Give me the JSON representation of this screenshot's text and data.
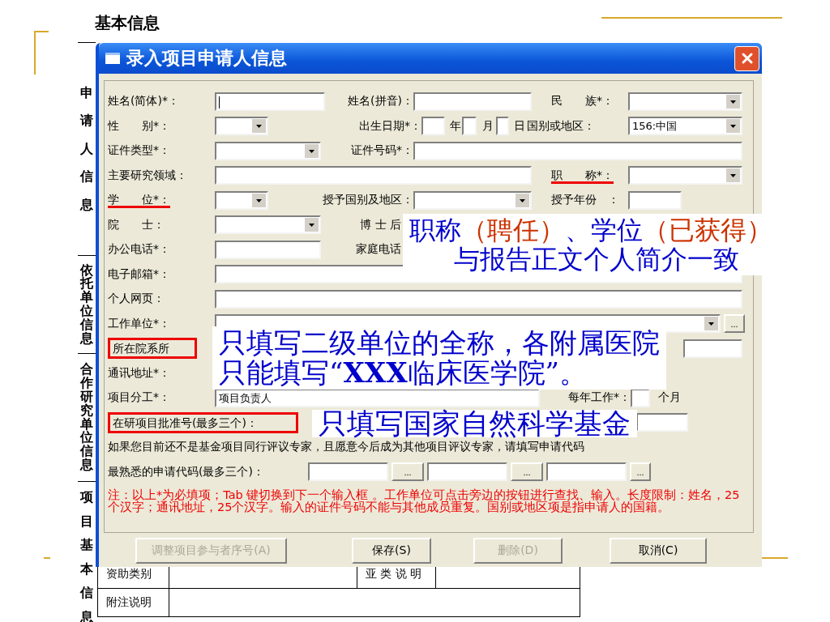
{
  "slide": {
    "heading": "基本信息",
    "side_sections": [
      {
        "label": "申请人信息"
      },
      {
        "label": "依托单位信息"
      },
      {
        "label": "合作研究单位信息"
      },
      {
        "label": "项目基本信息"
      }
    ],
    "table_rows": [
      {
        "cells": [
          "资助类别",
          "亚 类 说 明"
        ]
      },
      {
        "cells": [
          "附注说明"
        ]
      }
    ]
  },
  "dialog": {
    "title": "录入项目申请人信息",
    "rows": [
      {
        "items": [
          {
            "kind": "label",
            "text": "姓名(简体)*："
          },
          {
            "kind": "field",
            "focused": true
          },
          {
            "kind": "label",
            "text": "姓名(拼音)："
          },
          {
            "kind": "field"
          },
          {
            "kind": "label",
            "text": "民　　族*："
          },
          {
            "kind": "select"
          }
        ]
      },
      {
        "items": [
          {
            "kind": "label",
            "text": "性　　别*："
          },
          {
            "kind": "select"
          },
          {
            "kind": "label",
            "text": "出生日期*："
          },
          {
            "kind": "field"
          },
          {
            "kind": "unit",
            "text": "年"
          },
          {
            "kind": "field"
          },
          {
            "kind": "unit",
            "text": "月"
          },
          {
            "kind": "field"
          },
          {
            "kind": "unit",
            "text": "日"
          },
          {
            "kind": "label",
            "text": "国别或地区："
          },
          {
            "kind": "select",
            "value": "156:中国"
          }
        ]
      },
      {
        "items": [
          {
            "kind": "label",
            "text": "证件类型*："
          },
          {
            "kind": "select"
          },
          {
            "kind": "label",
            "text": "证件号码*："
          },
          {
            "kind": "field"
          }
        ]
      },
      {
        "items": [
          {
            "kind": "label",
            "text": "主要研究领域："
          },
          {
            "kind": "field"
          },
          {
            "kind": "label",
            "text": "职　　称*：",
            "underlined": true
          },
          {
            "kind": "select"
          }
        ]
      },
      {
        "items": [
          {
            "kind": "label",
            "text": "学　　位*：",
            "underlined": true
          },
          {
            "kind": "select"
          },
          {
            "kind": "label",
            "text": "授予国别及地区："
          },
          {
            "kind": "select"
          },
          {
            "kind": "label",
            "text": "授予年份　："
          },
          {
            "kind": "field"
          }
        ]
      },
      {
        "items": [
          {
            "kind": "label",
            "text": "院　　士："
          },
          {
            "kind": "select"
          },
          {
            "kind": "label",
            "text": "博 士 后"
          }
        ]
      },
      {
        "items": [
          {
            "kind": "label",
            "text": "办公电话*："
          },
          {
            "kind": "field"
          },
          {
            "kind": "label",
            "text": "家庭电话"
          }
        ]
      },
      {
        "items": [
          {
            "kind": "label",
            "text": "电子邮箱*："
          },
          {
            "kind": "field"
          }
        ]
      },
      {
        "items": [
          {
            "kind": "label",
            "text": "个人网页："
          },
          {
            "kind": "field"
          }
        ]
      },
      {
        "items": [
          {
            "kind": "label",
            "text": "工作单位*："
          },
          {
            "kind": "select"
          },
          {
            "kind": "browse_button",
            "text": "..."
          }
        ]
      },
      {
        "items": [
          {
            "kind": "label",
            "text": "所在院系所",
            "boxed": true
          },
          {
            "kind": "field"
          }
        ]
      },
      {
        "items": [
          {
            "kind": "label",
            "text": "通讯地址*："
          }
        ]
      },
      {
        "items": [
          {
            "kind": "label",
            "text": "项目分工*："
          },
          {
            "kind": "field",
            "value": "项目负责人"
          },
          {
            "kind": "label",
            "text": "每年工作*："
          },
          {
            "kind": "field"
          },
          {
            "kind": "unit",
            "text": "个月"
          }
        ]
      },
      {
        "items": [
          {
            "kind": "label",
            "text": "在研项目批准号(最多三个)：",
            "boxed": true
          },
          {
            "kind": "field"
          }
        ]
      },
      {
        "items": [
          {
            "kind": "text",
            "text": "如果您目前还不是基金项目同行评议专家，且愿意今后成为其他项目评议专家，请填写申请代码"
          }
        ]
      },
      {
        "items": [
          {
            "kind": "label",
            "text": "最熟悉的申请代码(最多三个)："
          },
          {
            "kind": "field"
          },
          {
            "kind": "browse_button",
            "text": "..."
          },
          {
            "kind": "field"
          },
          {
            "kind": "browse_button",
            "text": "..."
          },
          {
            "kind": "field"
          },
          {
            "kind": "browse_button",
            "text": "..."
          }
        ]
      }
    ],
    "note": "注：以上*为必填项；Tab 键切换到下一个输入框 。工作单位可点击旁边的按钮进行查找、输入。长度限制：姓名，25个汉字；通讯地址，25个汉字。输入的证件号码不能与其他成员重复。国别或地区项是指申请人的国籍。",
    "buttons": [
      {
        "label": "调整项目参与者序号(A)",
        "disabled": true
      },
      {
        "label": "保存(S)",
        "disabled": false
      },
      {
        "label": "删除(D)",
        "disabled": true
      },
      {
        "label": "取消(C)",
        "disabled": false
      }
    ]
  },
  "callouts": [
    {
      "lines": [
        {
          "segments": [
            {
              "text": "职称",
              "color": "#0000cc"
            },
            {
              "text": "（聘任）",
              "color": "#cc3300"
            },
            {
              "text": "、学位",
              "color": "#0000cc"
            },
            {
              "text": "（已获得）",
              "color": "#cc3300"
            }
          ]
        },
        {
          "segments": [
            {
              "text": "与报告正文个人简介一致",
              "color": "#0000cc"
            }
          ]
        }
      ]
    },
    {
      "lines": [
        {
          "segments": [
            {
              "text": "只填写二级单位的全称，各附属医院",
              "color": "#0000cc"
            }
          ]
        },
        {
          "segments": [
            {
              "text": "只能填写“**XXX**临床医学院”。",
              "color": "#0000cc"
            }
          ]
        }
      ]
    },
    {
      "lines": [
        {
          "segments": [
            {
              "text": "只填写国家自然科学基金",
              "color": "#0000cc"
            }
          ]
        }
      ]
    }
  ]
}
